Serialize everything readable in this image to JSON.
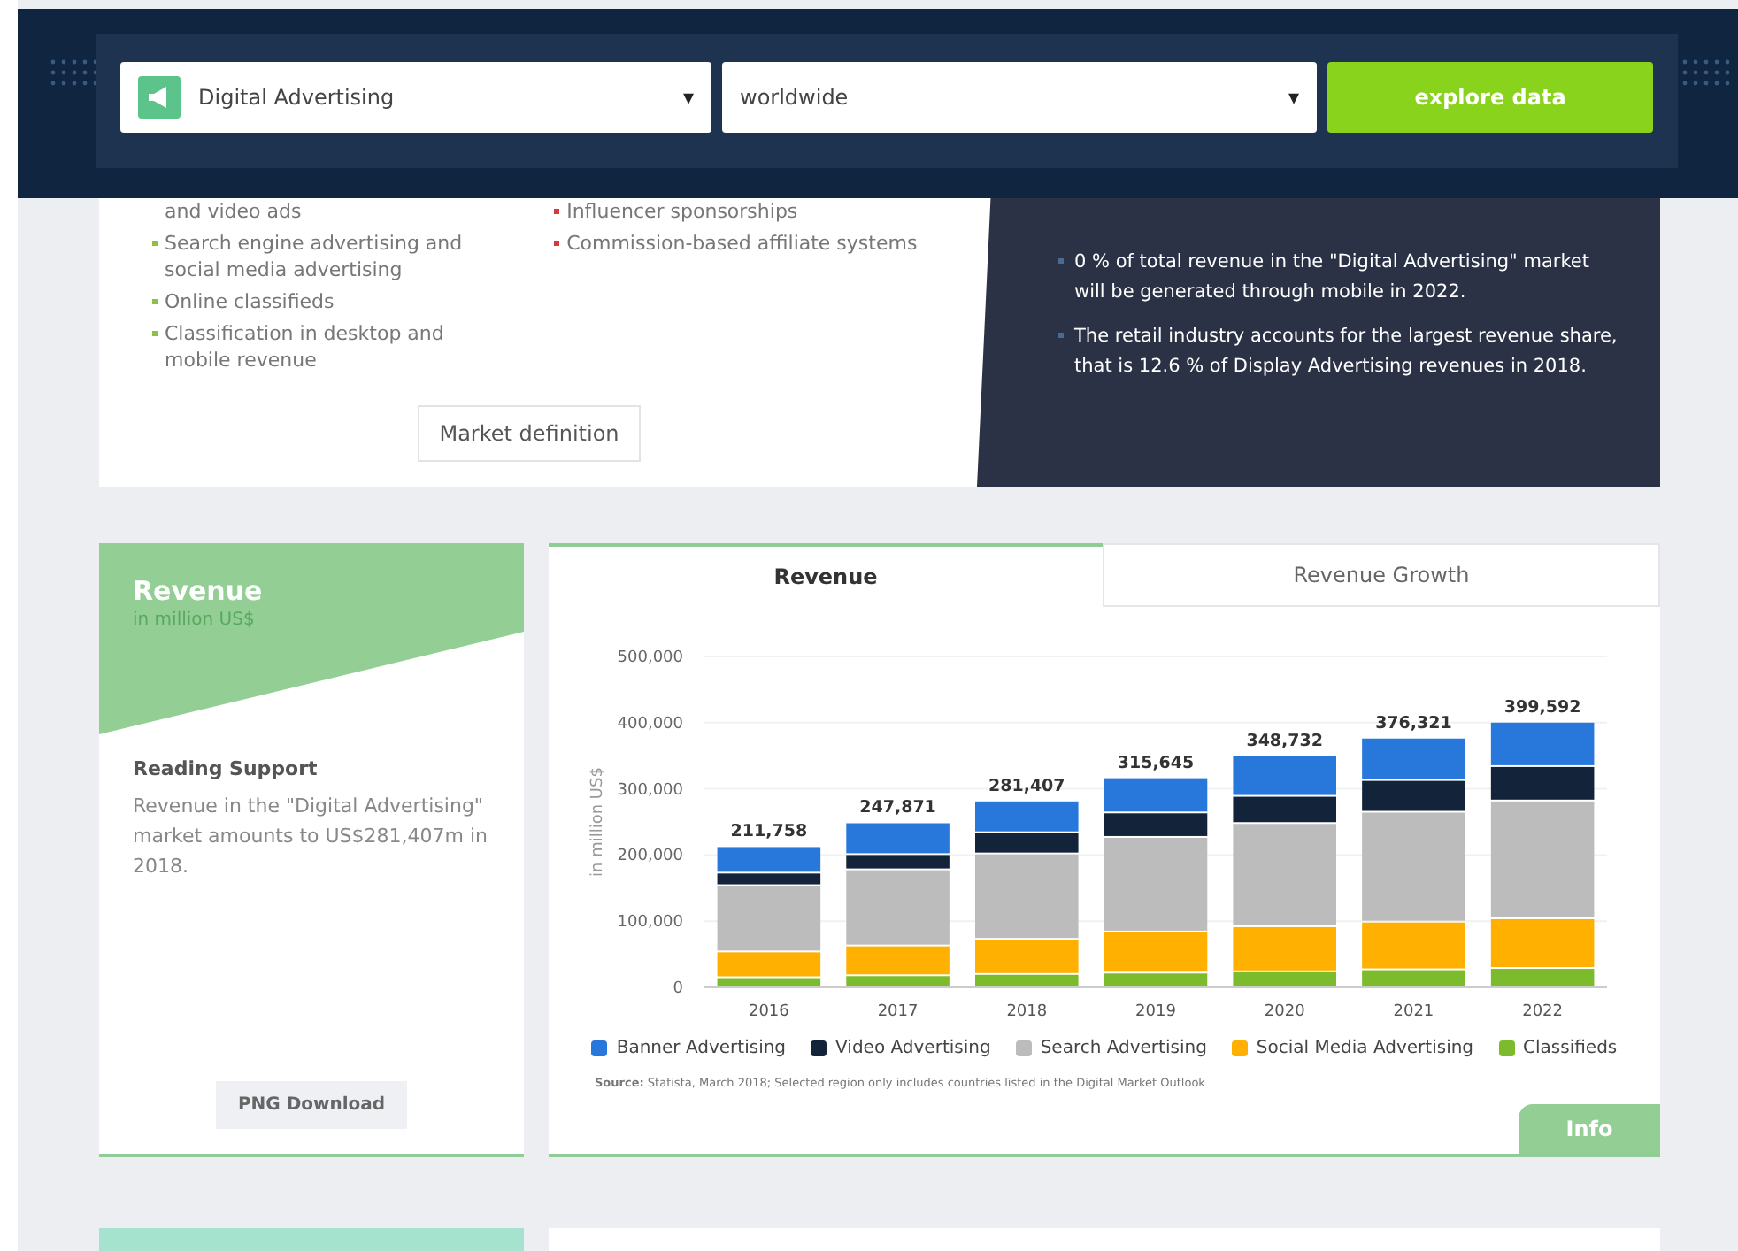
{
  "search_bar": {
    "market": {
      "value": "Digital Advertising",
      "caret": "▾"
    },
    "region": {
      "value": "worldwide",
      "caret": "▾"
    },
    "button": "explore data"
  },
  "definition": {
    "left_items": [
      {
        "text": "and video ads",
        "kind": "continuation"
      },
      {
        "text": "Search engine advertising and social media advertising",
        "kind": "item"
      },
      {
        "text": "Online classifieds",
        "kind": "item"
      },
      {
        "text": "Classification in desktop and mobile revenue",
        "kind": "item"
      }
    ],
    "right_items": [
      {
        "text": "Influencer sponsorships",
        "kind": "item"
      },
      {
        "text": "Commission-based affiliate systems",
        "kind": "item"
      }
    ],
    "button": "Market definition",
    "highlights": [
      "0 % of total revenue in the \"Digital Advertising\" market will be generated through mobile in 2022.",
      "The retail industry accounts for the largest revenue share, that is 12.6 % of Display Advertising revenues in 2018."
    ]
  },
  "revenue": {
    "title": "Revenue",
    "unit": "in million US$",
    "support_title": "Reading Support",
    "support_text": "Revenue in the \"Digital Advertising\" market amounts to US$281,407m in 2018.",
    "download": "PNG Download"
  },
  "chart_panel": {
    "tabs": [
      {
        "label": "Revenue",
        "selected": true
      },
      {
        "label": "Revenue Growth",
        "selected": false
      }
    ],
    "chart_data": {
      "type": "bar",
      "ylabel": "in million US$",
      "categories": [
        "2016",
        "2017",
        "2018",
        "2019",
        "2020",
        "2021",
        "2022"
      ],
      "stacked": true,
      "grid": true,
      "ylim": [
        0,
        500000
      ],
      "yticks": [
        {
          "value": 0,
          "label": "0"
        },
        {
          "value": 100000,
          "label": "100,000"
        },
        {
          "value": 200000,
          "label": "200,000"
        },
        {
          "value": 300000,
          "label": "300,000"
        },
        {
          "value": 400000,
          "label": "400,000"
        },
        {
          "value": 500000,
          "label": "500,000"
        }
      ],
      "series": [
        {
          "name": "Classifieds",
          "color": "#7cbb2b",
          "values": [
            14000,
            17000,
            19000,
            21000,
            23000,
            26000,
            28000
          ]
        },
        {
          "name": "Social Media Advertising",
          "color": "#ffb000",
          "values": [
            39000,
            45000,
            53000,
            62000,
            68000,
            72000,
            75000
          ]
        },
        {
          "name": "Search Advertising",
          "color": "#bcbcbc",
          "values": [
            100000,
            115000,
            129000,
            143000,
            156000,
            166000,
            178000
          ]
        },
        {
          "name": "Video Advertising",
          "color": "#13243a",
          "values": [
            19000,
            23000,
            32000,
            37000,
            41000,
            48000,
            52000
          ]
        },
        {
          "name": "Banner Advertising",
          "color": "#2878dc",
          "values": [
            40000,
            48000,
            48000,
            53000,
            61000,
            64000,
            67000
          ]
        }
      ],
      "value_labels": [
        "211,758",
        "247,871",
        "281,407",
        "315,645",
        "348,732",
        "376,321",
        "399,592"
      ]
    },
    "source_label": "Source:",
    "source_text": "Statista, March 2018; Selected region only includes countries listed in the Digital Market Outlook",
    "info": "Info"
  }
}
